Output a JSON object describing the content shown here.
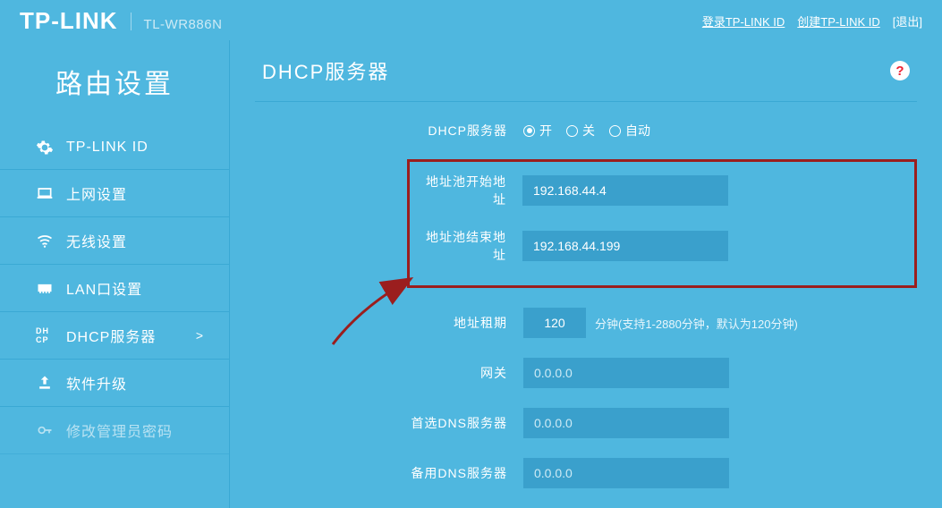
{
  "brand": {
    "logo": "TP-LINK",
    "model": "TL-WR886N"
  },
  "header": {
    "login_link": "登录TP-LINK ID",
    "create_link": "创建TP-LINK ID",
    "logout": "[退出]"
  },
  "sidebar": {
    "title": "路由设置",
    "items": [
      {
        "label": "TP-LINK ID"
      },
      {
        "label": "上网设置"
      },
      {
        "label": "无线设置"
      },
      {
        "label": "LAN口设置"
      },
      {
        "label": "DHCP服务器",
        "active": true
      },
      {
        "label": "软件升级"
      },
      {
        "label": "修改管理员密码"
      }
    ]
  },
  "main": {
    "title": "DHCP服务器",
    "help": "?",
    "server_label": "DHCP服务器",
    "radio_on": "开",
    "radio_off": "关",
    "radio_auto": "自动",
    "start_label": "地址池开始地址",
    "start_value": "192.168.44.4",
    "end_label": "地址池结束地址",
    "end_value": "192.168.44.199",
    "lease_label": "地址租期",
    "lease_value": "120",
    "lease_hint": "分钟(支持1-2880分钟，默认为120分钟)",
    "gateway_label": "网关",
    "gateway_value": "0.0.0.0",
    "dns1_label": "首选DNS服务器",
    "dns1_value": "0.0.0.0",
    "dns2_label": "备用DNS服务器",
    "dns2_value": "0.0.0.0"
  }
}
